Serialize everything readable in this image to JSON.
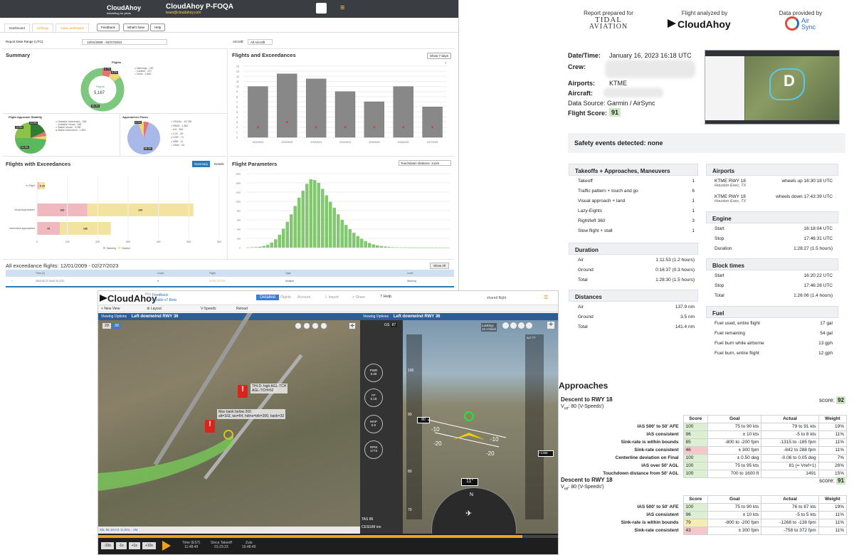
{
  "dashboard": {
    "app_name": "CloudAhoy",
    "app_tagline": "debriefing for pilots",
    "title": "CloudAhoy P-FOQA",
    "email": "team@cloudahoy.com",
    "tabs": [
      "Dashboard",
      "Settings",
      "Index and Notes"
    ],
    "buttons": [
      "Feedback",
      "What's New",
      "Help"
    ],
    "range_label": "Report Date Range (UTC):",
    "range_value": "12/01/2009 - 02/27/2023",
    "aircraft_label": "Aircraft:",
    "aircraft_value": "All Aircraft",
    "summary": {
      "title": "Summary",
      "flights_label": "Flights",
      "flights_count": "5,167",
      "legend": [
        "Warnings - 287",
        "Caution - 417",
        "None - 4,480"
      ],
      "warn_pct": "5.7%",
      "caution_pct": "8.2%",
      "none_pct": "86.3%",
      "stability_title": "Flight Approach Stability",
      "stability_legend": [
        "Unstable Instrument - 328",
        "Unstable Visual - 438",
        "Stable Visual - 3,038",
        "Stable Instrument - 1,892"
      ],
      "stability_pcts": [
        "52.8%",
        "34.8%",
        "13.5%"
      ],
      "approaches_title": "Approaches Flown",
      "approaches_legend": [
        "VISUAL - 15,789",
        "RNAV - 1,862",
        "ILS - 520",
        "LOC - 65",
        "VOR - 74",
        "NDB - 12",
        "Other - 44"
      ],
      "approaches_pcts": [
        "8.3%",
        "88.3%"
      ]
    },
    "flights_exceed": {
      "title": "Flights and Exceedances",
      "btn": "Show 7-days",
      "y_ticks": [
        "14",
        "13",
        "12",
        "11",
        "10",
        "9",
        "8",
        "7",
        "6",
        "5",
        "4",
        "3",
        "2",
        "1",
        "0"
      ],
      "dates": [
        "2/21/2023",
        "2/22/2023",
        "2/23/2023",
        "2/24/2023",
        "2/25/2023",
        "2/26/2023",
        "2/27/2023"
      ]
    },
    "fwe": {
      "title": "Flights with Exceedances",
      "tab_summary": "Summary",
      "tab_details": "Details",
      "rows": [
        {
          "label": "In Flight",
          "warn": "",
          "caution": "8 18"
        },
        {
          "label": "Visual Approaches",
          "warn": "166",
          "caution": "349"
        },
        {
          "label": "Instrument Approaches",
          "warn": "75",
          "caution": "168"
        }
      ],
      "x_ticks": [
        "0",
        "100",
        "200",
        "300",
        "400",
        "500",
        "600"
      ],
      "legend_warning": "Warning",
      "legend_caution": "Caution"
    },
    "params": {
      "title": "Flight Parameters",
      "select": "Touchdown distance: zoom",
      "y_ticks": [
        "1600",
        "1400",
        "1200",
        "1000",
        "800",
        "600",
        "400",
        "200",
        "0"
      ]
    },
    "all_exceed": {
      "title": "All exceedance flights: 12/01/2009 - 02/27/2023",
      "btn": "Show All",
      "headers": [
        "Time (Z)",
        "Count",
        "Flight",
        "Type",
        "Level"
      ],
      "row": [
        "2023-02-27 16:57:21 UTC",
        "8",
        "KTOE 2/27/23",
        "Multiple",
        "Warning"
      ]
    }
  },
  "report": {
    "prepared_for": "Report prepared for",
    "tidal_line1": "TIDAL",
    "tidal_line2": "AVIATION",
    "analyzed_by": "Flight analyzed by",
    "cloudahoy": "CloudAhoy",
    "provided_by": "Data provided by",
    "airsync_line1": "Air",
    "airsync_line2": "Sync",
    "datetime_label": "Date/Time:",
    "datetime_value": "January 16, 2023 16:18 UTC",
    "crew_label": "Crew:",
    "airports_label": "Airports:",
    "airports_value": "KTME",
    "aircraft_label": "Aircraft:",
    "data_source": "Data Source: Garmin / AirSync",
    "score_label": "Flight Score:",
    "score_value": "91",
    "safety": "Safety events detected: none",
    "takeoffs": {
      "title": "Takeoffs + Approaches, Maneuvers",
      "rows": [
        {
          "label": "Takeoff",
          "value": "1"
        },
        {
          "label": "Traffic pattern + touch and go",
          "value": "6"
        },
        {
          "label": "Visual approach + land",
          "value": "1"
        },
        {
          "label": "Lazy-Eights",
          "value": "1"
        },
        {
          "label": "Right/left 360",
          "value": "3"
        },
        {
          "label": "Slow flight + stall",
          "value": "1"
        }
      ]
    },
    "duration": {
      "title": "Duration",
      "rows": [
        {
          "label": "Air",
          "value": "1:11:53 (1.2 hours)"
        },
        {
          "label": "Ground",
          "value": "0:16:37 (0.3 hours)"
        },
        {
          "label": "Total",
          "value": "1:28:30 (1.5 hours)"
        }
      ]
    },
    "distances": {
      "title": "Distances",
      "rows": [
        {
          "label": "Air",
          "value": "137.9 nm"
        },
        {
          "label": "Ground",
          "value": "3.5 nm"
        },
        {
          "label": "Total",
          "value": "141.4 nm"
        }
      ]
    },
    "airports": {
      "title": "Airports",
      "rows": [
        {
          "label": "KTME RWY 18",
          "sub": "Houston Exec, TX",
          "value": "wheels up 16:30:18 UTC"
        },
        {
          "label": "KTME RWY 18",
          "sub": "Houston Exec, TX",
          "value": "wheels down 17:43:39 UTC"
        }
      ]
    },
    "engine": {
      "title": "Engine",
      "rows": [
        {
          "label": "Start",
          "value": "16:18:04 UTC"
        },
        {
          "label": "Stop",
          "value": "17:46:31 UTC"
        },
        {
          "label": "Duration",
          "value": "1:28:27 (1.5 hours)"
        }
      ]
    },
    "block": {
      "title": "Block times",
      "rows": [
        {
          "label": "Start",
          "value": "16:20:22 UTC"
        },
        {
          "label": "Stop",
          "value": "17:46:28 UTC"
        },
        {
          "label": "Total",
          "value": "1:26:06 (1.4 hours)"
        }
      ]
    },
    "fuel": {
      "title": "Fuel",
      "rows": [
        {
          "label": "Fuel used, entire flight",
          "value": "17 gal"
        },
        {
          "label": "Fuel remaining",
          "value": "54 gal"
        },
        {
          "label": "Fuel burn while airborne",
          "value": "13 gph"
        },
        {
          "label": "Fuel burn, entire flight",
          "value": "12 gph"
        }
      ]
    },
    "approaches_title": "Approaches",
    "desc1": {
      "title": "Descent to RWY 18",
      "vref": "V",
      "vref_sub": "ref",
      "vref_rest": ": 80 (V-Speeds')",
      "score": "92",
      "score_label": "score:"
    },
    "desc2": {
      "title": "Descent to RWY 18",
      "vref": "V",
      "vref_sub": "ref",
      "vref_rest": ": 80 (V-Speeds')",
      "score": "91",
      "score_label": "score:"
    },
    "table_headers": [
      "Score",
      "Goal",
      "Actual",
      "Weight"
    ],
    "table1": [
      {
        "label": "IAS 500' to 50' AFE",
        "score": "100",
        "goal": "75 to 90 kts",
        "actual": "79 to 91 kts",
        "weight": "19%",
        "c": "g"
      },
      {
        "label": "IAS consistent",
        "score": "96",
        "goal": "± 10 kts",
        "actual": "-5 to 8 kts",
        "weight": "11%",
        "c": "g"
      },
      {
        "label": "Sink-rate is within bounds",
        "score": "85",
        "goal": "-800 to -200 fpm",
        "actual": "-1315 to -185 fpm",
        "weight": "11%",
        "c": "g"
      },
      {
        "label": "Sink-rate consistent",
        "score": "46",
        "goal": "± 300 fpm",
        "actual": "-842 to 288 fpm",
        "weight": "11%",
        "c": "r2"
      },
      {
        "label": "Centerline deviation on Final",
        "score": "100",
        "goal": "± 0.50 deg",
        "actual": "-0.06 to 0.05 deg",
        "weight": "7%",
        "c": "g"
      },
      {
        "label": "IAS over 50' AGL",
        "score": "100",
        "goal": "75 to 95 kts",
        "actual": "81 (= Vref+1)",
        "weight": "26%",
        "c": "g"
      },
      {
        "label": "Touchdown distance from 50' AGL",
        "score": "100",
        "goal": "700 to 1600 ft",
        "actual": "1491",
        "weight": "15%",
        "c": "g"
      }
    ],
    "table2": [
      {
        "label": "IAS 500' to 50' AFE",
        "score": "100",
        "goal": "75 to 90 kts",
        "actual": "76 to 87 kts",
        "weight": "19%",
        "c": "g"
      },
      {
        "label": "IAS consistent",
        "score": "96",
        "goal": "± 10 kts",
        "actual": "-5 to 5 kts",
        "weight": "11%",
        "c": "g"
      },
      {
        "label": "Sink-rate is within bounds",
        "score": "79",
        "goal": "-800 to -200 fpm",
        "actual": "-1268 to -138 fpm",
        "weight": "11%",
        "c": "y"
      },
      {
        "label": "Sink-rate consistent",
        "score": "43",
        "goal": "± 300 fpm",
        "actual": "-758 to 372 fpm",
        "weight": "11%",
        "c": "r2"
      }
    ]
  },
  "view": {
    "logo": "CloudAhoy",
    "pro": "Pro",
    "feedback": "Feedback",
    "enable": "Enable v7 Beta",
    "new_view": "New View",
    "layout": "Layout",
    "vspeeds": "V-Speeds",
    "reload": "Reload",
    "detailed": "Detailed",
    "flights": "Flights",
    "account": "Account",
    "import": "Import",
    "share": "Share",
    "help": "Help",
    "shared": "shared flight",
    "viewing": "Viewing Options",
    "phase": "Left downwind RWY 36",
    "btn_2d": "2D",
    "btn_3d": "3D",
    "callout1": "THI.D: high AGL-TCH\nAGL-TCH=52",
    "callout2": "Max bank below 200\nalt=163, ias=64, hdms=bfx=200, bank=32",
    "looking": "Looking:",
    "looking2": "12 o'clock",
    "gs": "GS",
    "gs_val": "87",
    "pwr": "PWR",
    "pwr_val": "0.00",
    "ff": "FF",
    "ff_val": "0.18",
    "map": "MAP",
    "map_val": "0.0",
    "rpm": "RPM",
    "rpm_val": "1773",
    "tas": "TAS",
    "tas_val": "86",
    "heading": "11°",
    "alt_label": "ALT FT",
    "ias_label": "80",
    "tape_top": "100",
    "tape_mid": "90",
    "tape_low": "80",
    "tape_70": "70",
    "cesium": "CESIUM ion",
    "time_est": "Time (EST)",
    "time_est_val": "11:48:49",
    "since": "Since Takeoff",
    "since_val": "01:23:23",
    "zulu": "Zulu",
    "zulu_val": "16:48:49",
    "rewind": [
      "-10s",
      "-1s",
      "+1s",
      "+10s"
    ],
    "status": "36L  86.1KIAS  11.8GL  -  2M"
  },
  "chart_data": [
    {
      "type": "bar",
      "title": "Flights and Exceedances",
      "categories": [
        "2/21/2023",
        "2/22/2023",
        "2/23/2023",
        "2/24/2023",
        "2/25/2023",
        "2/26/2023",
        "2/27/2023"
      ],
      "values": [
        10,
        12.5,
        11.5,
        9,
        7,
        10,
        6
      ],
      "exceed": [
        2,
        3,
        2,
        2,
        2,
        2,
        2
      ],
      "ylim": [
        0,
        14
      ]
    },
    {
      "type": "bar",
      "title": "Flights with Exceedances",
      "categories": [
        "In Flight",
        "Visual Approaches",
        "Instrument Approaches"
      ],
      "series": [
        {
          "name": "Warning",
          "values": [
            8,
            166,
            75
          ]
        },
        {
          "name": "Caution",
          "values": [
            18,
            349,
            168
          ]
        }
      ],
      "xlim": [
        0,
        600
      ]
    },
    {
      "type": "bar",
      "title": "Flight Parameters",
      "values": [
        5,
        8,
        12,
        20,
        35,
        60,
        110,
        180,
        280,
        410,
        560,
        720,
        900,
        1080,
        1230,
        1380,
        1480,
        1460,
        1400,
        1270,
        1130,
        990,
        860,
        720,
        600,
        490,
        400,
        320,
        250,
        190,
        140,
        100,
        70,
        50,
        35,
        24,
        16,
        10,
        8,
        6,
        4,
        3,
        2,
        2,
        1,
        1,
        1,
        1,
        1,
        1,
        1,
        1
      ],
      "ylim": [
        0,
        1600
      ]
    },
    {
      "type": "pie",
      "title": "Summary",
      "categories": [
        "Warnings",
        "Caution",
        "None"
      ],
      "values": [
        287,
        417,
        4480
      ]
    },
    {
      "type": "pie",
      "title": "Flight Approach Stability",
      "categories": [
        "Unstable Instrument",
        "Unstable Visual",
        "Stable Visual",
        "Stable Instrument"
      ],
      "values": [
        328,
        438,
        3038,
        1892
      ]
    },
    {
      "type": "pie",
      "title": "Approaches Flown",
      "categories": [
        "VISUAL",
        "RNAV",
        "ILS",
        "LOC",
        "VOR",
        "NDB",
        "Other"
      ],
      "values": [
        15789,
        1862,
        520,
        65,
        74,
        12,
        44
      ]
    }
  ]
}
